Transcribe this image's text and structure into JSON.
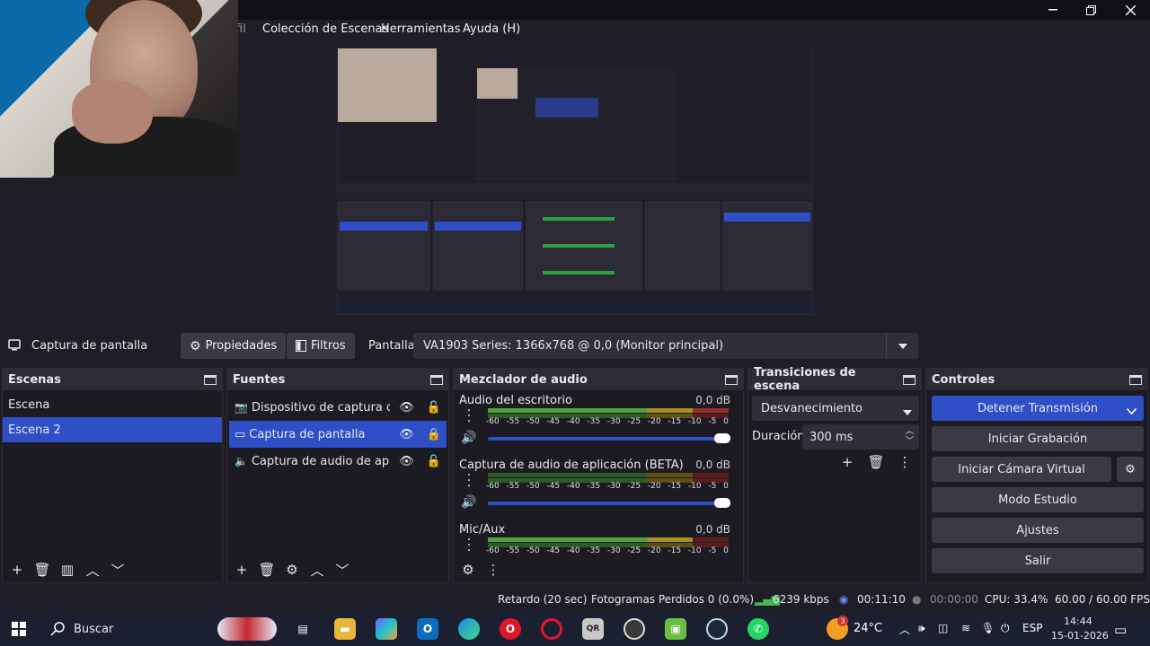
{
  "menu": {
    "partial": "fil",
    "items": [
      "Colección de Escenas",
      "Herramientas",
      "Ayuda (H)"
    ]
  },
  "source_toolbar": {
    "source_name": "Captura de pantalla",
    "properties": "Propiedades",
    "filters": "Filtros",
    "display_label": "Pantalla",
    "display_value": "VA1903 Series: 1366x768 @ 0,0 (Monitor principal)"
  },
  "scenes": {
    "title": "Escenas",
    "items": [
      "Escena",
      "Escena 2"
    ]
  },
  "sources": {
    "title": "Fuentes",
    "items": [
      "Dispositivo de captura de vide",
      "Captura de pantalla",
      "Captura de audio de aplicació"
    ]
  },
  "mixer": {
    "title": "Mezclador de audio",
    "ticks": [
      "-60",
      "-55",
      "-50",
      "-45",
      "-40",
      "-35",
      "-30",
      "-25",
      "-20",
      "-15",
      "-10",
      "-5",
      "0"
    ],
    "channels": [
      {
        "name": "Audio del escritorio",
        "db": "0,0 dB"
      },
      {
        "name": "Captura de audio de aplicación (BETA)",
        "db": "0,0 dB"
      },
      {
        "name": "Mic/Aux",
        "db": "0,0 dB"
      }
    ]
  },
  "transitions": {
    "title": "Transiciones de escena",
    "selected": "Desvanecimiento",
    "duration_label": "Duración",
    "duration_value": "300 ms"
  },
  "controls": {
    "title": "Controles",
    "stop_stream": "Detener Transmisión",
    "start_recording": "Iniciar Grabación",
    "virtual_cam": "Iniciar Cámara Virtual",
    "studio_mode": "Modo Estudio",
    "settings": "Ajustes",
    "exit": "Salir"
  },
  "status": {
    "delay": "Retardo (20 sec)",
    "dropped": "Fotogramas Perdidos 0 (0.0%)",
    "bitrate": "6239 kbps",
    "stream_time": "00:11:10",
    "rec_time": "00:00:00",
    "cpu": "CPU: 33.4%",
    "fps": "60.00 / 60.00 FPS"
  },
  "taskbar": {
    "search": "Buscar",
    "weather": "24°C",
    "weather_badge": "3",
    "lang": "ESP",
    "time": "14:44",
    "date": "15-01-2026"
  },
  "colors": {
    "accent": "#2f4fc6",
    "background": "#1f1e26",
    "dock_header": "#2c2b36"
  }
}
